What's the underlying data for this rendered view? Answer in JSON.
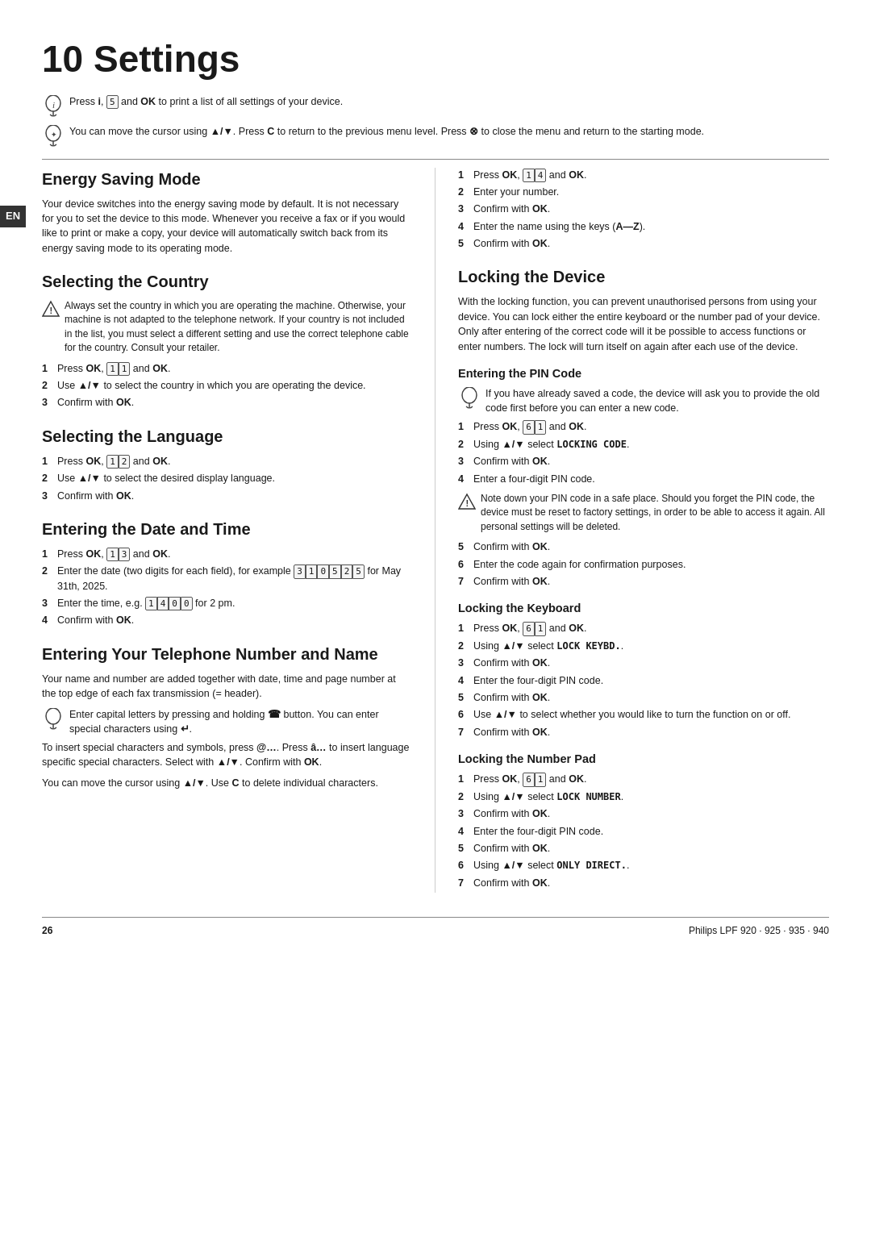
{
  "page": {
    "title": "10 Settings",
    "footer_left": "26",
    "footer_right": "Philips LPF 920 · 925 · 935 · 940"
  },
  "en_badge": "EN",
  "intro": {
    "tip1": "Press i, 5 and OK to print a list of all settings of your device.",
    "tip2": "You can move the cursor using ▲/▼. Press C to return to the previous menu level. Press ⊗ to close the menu and return to the starting mode."
  },
  "sections": {
    "energy_saving_mode": {
      "title": "Energy Saving Mode",
      "body": "Your device switches into the energy saving mode by default. It is not necessary for you to set the device to this mode. Whenever you receive a fax or if you would like to print or make a copy, your device will automatically switch back from its energy saving mode to its operating mode."
    },
    "selecting_country": {
      "title": "Selecting the Country",
      "warning": "Always set the country in which you are operating the machine. Otherwise, your machine is not adapted to the telephone network. If your country is not included in the list, you must select a different setting and use the correct telephone cable for the country. Consult your retailer.",
      "steps": [
        "Press OK, 1 1 and OK.",
        "Use ▲/▼ to select the country in which you are operating the device.",
        "Confirm with OK."
      ]
    },
    "selecting_language": {
      "title": "Selecting the Language",
      "steps": [
        "Press OK, 1 2 and OK.",
        "Use ▲/▼ to select the desired display language.",
        "Confirm with OK."
      ]
    },
    "entering_date_time": {
      "title": "Entering the Date and Time",
      "steps": [
        "Press OK, 1 3 and OK.",
        "Enter the date (two digits for each field), for example 3 1 0 5 2 5 for May 31th, 2025.",
        "Enter the time, e.g. 1 4 0 0 for 2 pm.",
        "Confirm with OK."
      ]
    },
    "telephone_number_name": {
      "title": "Entering Your Telephone Number and Name",
      "body": "Your name and number are added together with date, time and page number at the top edge of each fax transmission (= header).",
      "tip1": "Enter capital letters by pressing and holding ☎ button. You can enter special characters using ↵.",
      "tip2": "To insert special characters and symbols, press @…. Press â… to insert language specific special characters. Select with ▲/▼. Confirm with OK.",
      "tip3": "You can move the cursor using ▲/▼. Use C to delete individual characters.",
      "steps": [
        "Press OK, 1 4 and OK.",
        "Enter your number.",
        "Confirm with OK.",
        "Enter the name using the keys (A—Z).",
        "Confirm with OK."
      ]
    },
    "locking_device": {
      "title": "Locking the Device",
      "body": "With the locking function, you can prevent unauthorised persons from using your device. You can lock either the entire keyboard or the number pad of your device. Only after entering of the correct code will it be possible to access functions or enter numbers. The lock will turn itself on again after each use of the device."
    },
    "entering_pin": {
      "title": "Entering the PIN Code",
      "tip": "If you have already saved a code, the device will ask you to provide the old code first before you can enter a new code.",
      "steps": [
        "Press OK, 6 1 and OK.",
        "Using ▲/▼ select LOCKING CODE.",
        "Confirm with OK.",
        "Enter a four-digit PIN code.",
        "Confirm with OK.",
        "Enter the code again for confirmation purposes.",
        "Confirm with OK."
      ],
      "warning": "Note down your PIN code in a safe place. Should you forget the PIN code, the device must be reset to factory settings, in order to be able to access it again. All personal settings will be deleted."
    },
    "locking_keyboard": {
      "title": "Locking the Keyboard",
      "steps": [
        "Press OK, 6 1 and OK.",
        "Using ▲/▼ select LOCK KEYBD..",
        "Confirm with OK.",
        "Enter the four-digit PIN code.",
        "Confirm with OK.",
        "Use ▲/▼ to select whether you would like to turn the function on or off.",
        "Confirm with OK."
      ]
    },
    "locking_number_pad": {
      "title": "Locking the Number Pad",
      "steps": [
        "Press OK, 6 1 and OK.",
        "Using ▲/▼ select LOCK NUMBER.",
        "Confirm with OK.",
        "Enter the four-digit PIN code.",
        "Confirm with OK.",
        "Using ▲/▼ select ONLY DIRECT..",
        "Confirm with OK."
      ]
    }
  }
}
